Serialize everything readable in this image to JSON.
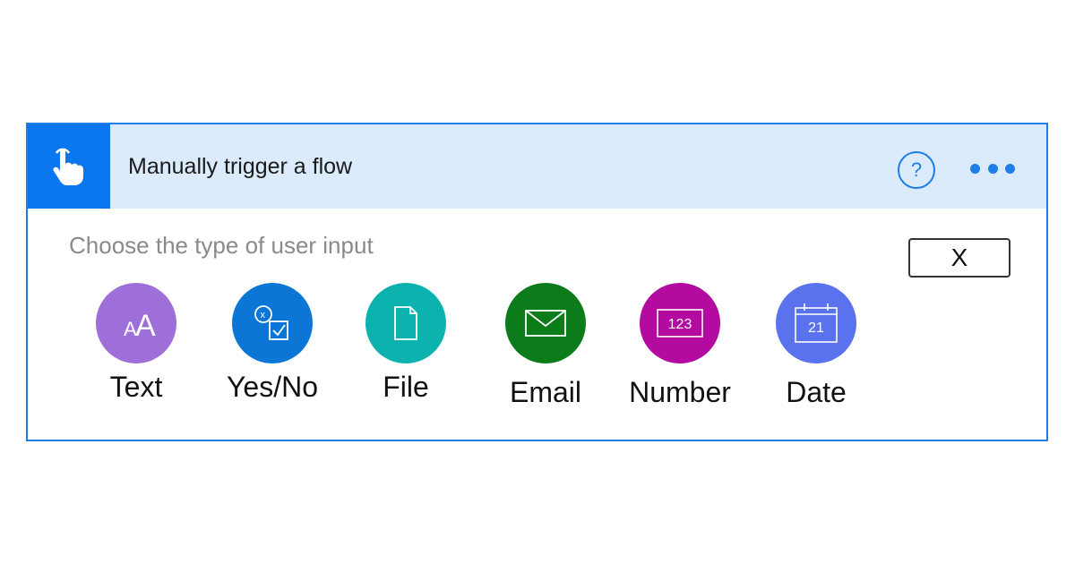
{
  "header": {
    "title": "Manually trigger a flow",
    "trigger_icon": "hand-pointer-icon",
    "help_label": "?",
    "more_icon": "ellipsis-icon"
  },
  "panel": {
    "prompt": "Choose the type of user input",
    "close_label": "X"
  },
  "options": [
    {
      "label": "Text",
      "icon": "text-aa-icon",
      "color": "#9f6fd9"
    },
    {
      "label": "Yes/No",
      "icon": "yes-no-checkbox-icon",
      "color": "#0b76d6"
    },
    {
      "label": "File",
      "icon": "file-icon",
      "color": "#0cb3ae"
    },
    {
      "label": "Email",
      "icon": "envelope-icon",
      "color": "#0c7c1b"
    },
    {
      "label": "Number",
      "icon": "number-icon",
      "glyph": "123",
      "color": "#b30aa0"
    },
    {
      "label": "Date",
      "icon": "calendar-icon",
      "glyph": "21",
      "color": "#5b72ee"
    }
  ],
  "colors": {
    "accent": "#1f7de6",
    "header_bg": "#dbebfb",
    "trigger_tile": "#0a77f0"
  }
}
